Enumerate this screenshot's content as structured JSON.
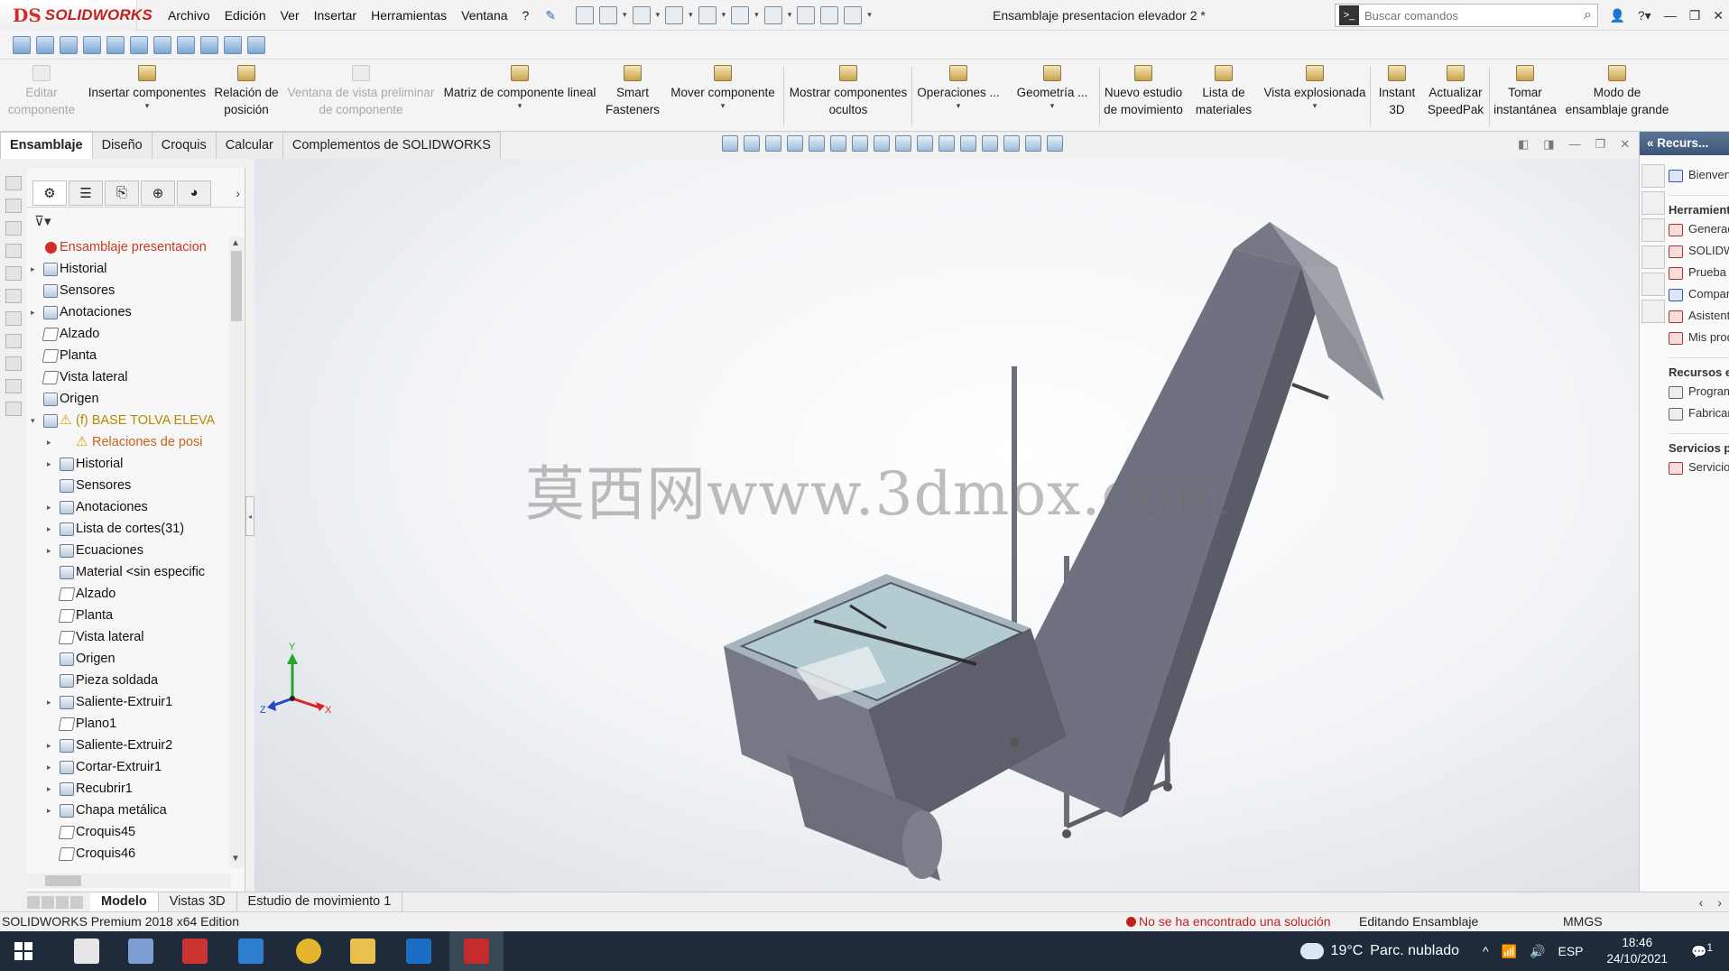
{
  "app": {
    "logo": "SOLIDWORKS",
    "doc_title": "Ensamblaje presentacion elevador 2 *",
    "menu": [
      "Archivo",
      "Edición",
      "Ver",
      "Insertar",
      "Herramientas",
      "Ventana",
      "?"
    ],
    "search_placeholder": "Buscar comandos"
  },
  "commands": {
    "editar": "Editar componente",
    "insertar": "Insertar componentes",
    "relacion": "Relación de posición",
    "ventana": "Ventana de vista preliminar de componente",
    "matriz": "Matriz de componente lineal",
    "smart": "Smart Fasteners",
    "mover": "Mover componente",
    "mostrar": "Mostrar componentes ocultos",
    "operaciones": "Operaciones ...",
    "geometria": "Geometría ...",
    "nuevo": "Nuevo estudio de movimiento",
    "lista": "Lista de materiales",
    "vista": "Vista explosionada",
    "instant": "Instant 3D",
    "actualizar": "Actualizar SpeedPak",
    "tomar": "Tomar instantánea",
    "modo": "Modo de ensamblaje grande"
  },
  "tabs": [
    "Ensamblaje",
    "Diseño",
    "Croquis",
    "Calcular",
    "Complementos de SOLIDWORKS"
  ],
  "tree": [
    {
      "label": "Ensamblaje presentacion",
      "style": "red"
    },
    {
      "label": "Historial"
    },
    {
      "label": "Sensores"
    },
    {
      "label": "Anotaciones"
    },
    {
      "label": "Alzado"
    },
    {
      "label": "Planta"
    },
    {
      "label": "Vista lateral"
    },
    {
      "label": "Origen"
    },
    {
      "label": "(f) BASE TOLVA ELEVA",
      "style": "warn"
    },
    {
      "label": "Relaciones de posi",
      "style": "orange"
    },
    {
      "label": "Historial"
    },
    {
      "label": "Sensores"
    },
    {
      "label": "Anotaciones"
    },
    {
      "label": "Lista de cortes(31)"
    },
    {
      "label": "Ecuaciones"
    },
    {
      "label": "Material <sin especific"
    },
    {
      "label": "Alzado"
    },
    {
      "label": "Planta"
    },
    {
      "label": "Vista lateral"
    },
    {
      "label": "Origen"
    },
    {
      "label": "Pieza soldada"
    },
    {
      "label": "Saliente-Extruir1"
    },
    {
      "label": "Plano1"
    },
    {
      "label": "Saliente-Extruir2"
    },
    {
      "label": "Cortar-Extruir1"
    },
    {
      "label": "Recubrir1"
    },
    {
      "label": "Chapa metálica"
    },
    {
      "label": "Croquis45"
    },
    {
      "label": "Croquis46"
    }
  ],
  "watermark": "莫西网www.3dmox.com",
  "triad": {
    "x": "X",
    "y": "Y",
    "z": "Z"
  },
  "taskpane": {
    "header": "Recurs...",
    "welcome": "Bienvenido a SOLIDWORKS",
    "tools_head": "Herramientas de SOLIDWORKS",
    "tools": [
      "Generador de pestaña de propiedades",
      "SOLIDWORKS",
      "Prueba de rendimiento",
      "Comparar",
      "Asistente para copiar configuración",
      "Mis productos"
    ],
    "resources_head": "Recursos en línea",
    "resources": [
      "Programa \"Partners\" de SolidWorks",
      "Fabricante"
    ],
    "services_head": "Servicios por suscripción",
    "services": [
      "Servicios por suscripción"
    ]
  },
  "bottom_tabs": [
    "Modelo",
    "Vistas 3D",
    "Estudio de movimiento 1"
  ],
  "status": {
    "edition": "SOLIDWORKS Premium 2018 x64 Edition",
    "error": "No se ha encontrado una solución",
    "mode": "Editando Ensamblaje",
    "units": "MMGS"
  },
  "taskbar": {
    "temp": "19°C",
    "weather": "Parc. nublado",
    "lang": "ESP",
    "time": "18:46",
    "date": "24/10/2021",
    "notif": "1"
  },
  "colors": {
    "accent": "#c21f1f",
    "taskbar": "#1f2b3a",
    "error": "#c41f1f"
  }
}
